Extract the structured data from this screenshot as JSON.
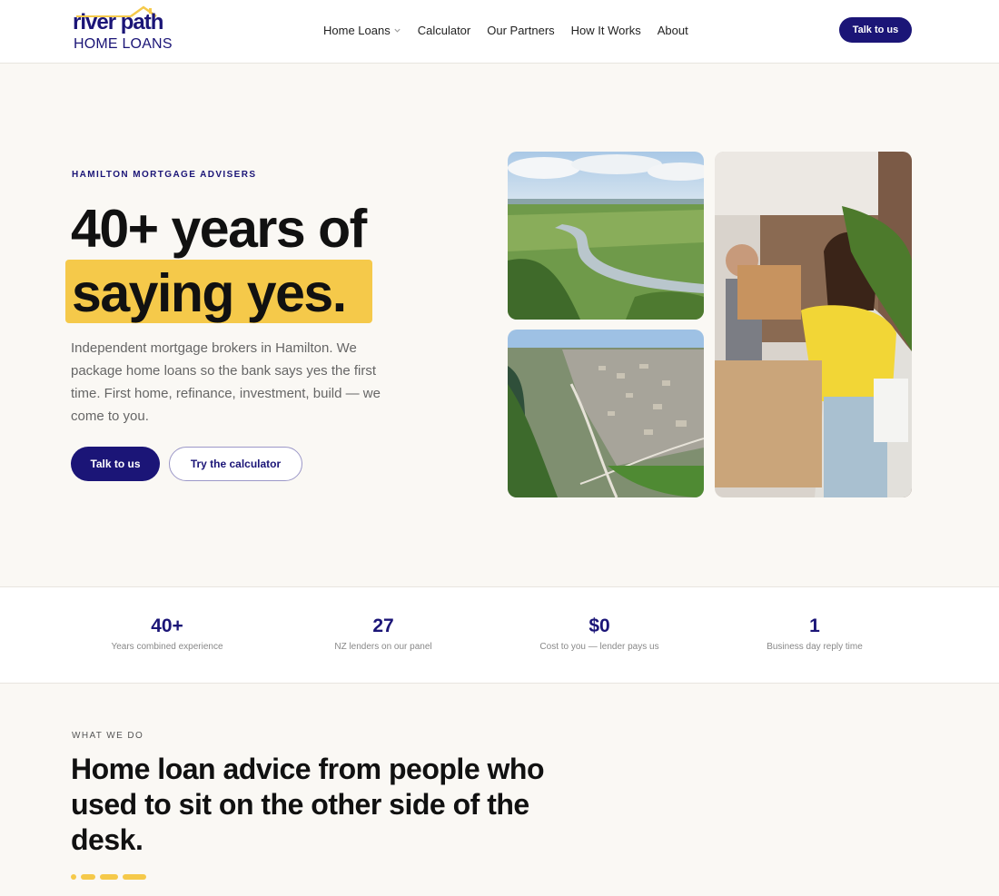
{
  "brand": {
    "name_line1": "river path",
    "name_line2": "HOME LOANS",
    "primary_color": "#1b1577",
    "accent_color": "#f5c94a"
  },
  "nav": {
    "items": [
      {
        "label": "Home Loans",
        "has_dropdown": true
      },
      {
        "label": "Calculator"
      },
      {
        "label": "Our Partners"
      },
      {
        "label": "How It Works"
      },
      {
        "label": "About"
      }
    ],
    "cta_label": "Talk to us"
  },
  "hero": {
    "eyebrow": "HAMILTON MORTGAGE ADVISERS",
    "title_line1": "40+ years of",
    "title_line2": "saying yes.",
    "lede": "Independent mortgage brokers in Hamilton. We package home loans so the bank says yes the first time. First home, refinance, investment, build — we come to you.",
    "primary_cta": "Talk to us",
    "secondary_cta": "Try the calculator"
  },
  "stats": [
    {
      "value": "40+",
      "label": "Years combined experience"
    },
    {
      "value": "27",
      "label": "NZ lenders on our panel"
    },
    {
      "value": "$0",
      "label": "Cost to you — lender pays us"
    },
    {
      "value": "1",
      "label": "Business day reply time"
    }
  ],
  "what_we_do": {
    "eyebrow": "WHAT WE DO",
    "title": "Home loan advice from people who used to sit on the other side of the desk."
  }
}
